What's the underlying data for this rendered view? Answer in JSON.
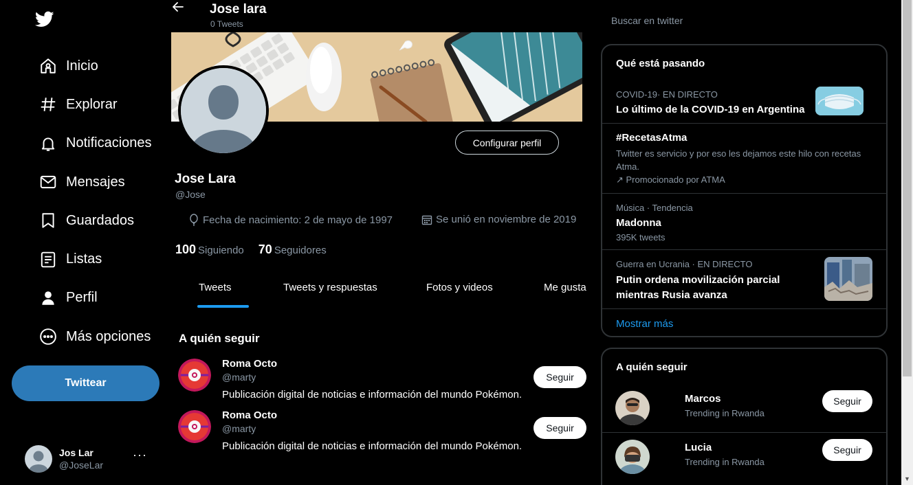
{
  "sidebar": {
    "items": [
      {
        "label": "Inicio",
        "icon": "home-icon"
      },
      {
        "label": "Explorar",
        "icon": "hashtag-icon"
      },
      {
        "label": "Notificaciones",
        "icon": "bell-icon"
      },
      {
        "label": "Mensajes",
        "icon": "envelope-icon"
      },
      {
        "label": "Guardados",
        "icon": "bookmark-icon"
      },
      {
        "label": "Listas",
        "icon": "list-icon"
      },
      {
        "label": "Perfil",
        "icon": "person-icon"
      },
      {
        "label": "Más opciones",
        "icon": "more-circle-icon"
      }
    ],
    "tweet_button": "Twittear",
    "account": {
      "name": "Jos Lar",
      "handle": "@JoseLar",
      "more": "···"
    }
  },
  "header": {
    "title": "Jose lara",
    "subtitle": "0 Tweets"
  },
  "profile": {
    "edit_button": "Configurar perfil",
    "name": "Jose Lara",
    "handle": "@Jose",
    "birth": "Fecha de nacimiento: 2 de mayo de 1997",
    "joined": "Se unió en noviembre de 2019",
    "following_count": "100",
    "following_label": "Siguiendo",
    "followers_count": "70",
    "followers_label": "Seguidores"
  },
  "tabs": [
    "Tweets",
    "Tweets y respuestas",
    "Fotos y videos",
    "Me gusta"
  ],
  "who_to_follow_main": {
    "title": "A quién seguir",
    "accounts": [
      {
        "name": "Roma Octo",
        "handle": "@marty",
        "bio": "Publicación digital de noticias e información del mundo Pokémon.",
        "button": "Seguir"
      },
      {
        "name": "Roma Octo",
        "handle": "@marty",
        "bio": "Publicación digital de noticias e información del mundo Pokémon.",
        "button": "Seguir"
      }
    ]
  },
  "search": {
    "placeholder": "Buscar en twitter"
  },
  "trends": {
    "title": "Qué está pasando",
    "items": [
      {
        "context": "COVID-19· EN DIRECTO",
        "title": "Lo último de la COVID-19 en Argentina"
      },
      {
        "title": "#RecetasAtma",
        "desc": "Twitter es servicio y por eso les dejamos este hilo con recetas Atma.",
        "promo": "↗ Promocionado por ATMA"
      },
      {
        "context": "Música · Tendencia",
        "title": "Madonna",
        "count": "395K tweets"
      },
      {
        "context": "Guerra en Ucrania · EN DIRECTO",
        "title": "Putin ordena movilización parcial mientras Rusia avanza"
      }
    ],
    "show_more": "Mostrar más"
  },
  "who_to_follow_side": {
    "title": "A quién seguir",
    "accounts": [
      {
        "name": "Marcos",
        "sub": "Trending in Rwanda",
        "button": "Seguir"
      },
      {
        "name": "Lucia",
        "sub": "Trending in Rwanda",
        "button": "Seguir"
      }
    ]
  },
  "colors": {
    "accent": "#1d9bf0",
    "tweet_button": "#2c7ab8",
    "background": "#000000",
    "muted": "#8b98a5"
  }
}
